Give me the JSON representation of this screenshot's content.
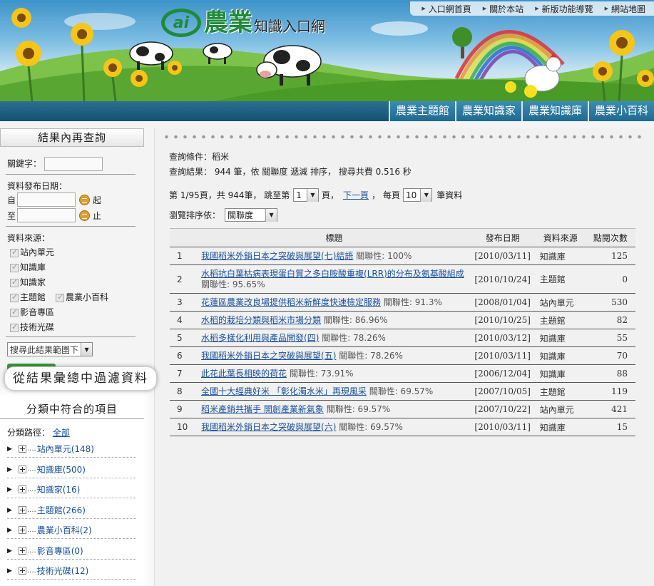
{
  "header": {
    "logo_main": "農業",
    "logo_sub": "知識入口網",
    "top_links": [
      "入口網首頁",
      "關於本站",
      "新版功能導覽",
      "網站地圖"
    ],
    "nav_tabs": [
      "農業主題館",
      "農業知識家",
      "農業知識庫",
      "農業小百科"
    ]
  },
  "left": {
    "search_title": "結果內再查詢",
    "keyword_label": "關鍵字：",
    "date_label": "資料發布日期：",
    "from_label": "自",
    "to_label": "至",
    "start_label": "起",
    "end_label": "止",
    "source_label": "資料來源：",
    "sources": [
      "站內單元",
      "知識庫",
      "知識家",
      "主題館",
      "農業小百科",
      "影音專區",
      "技術光碟"
    ],
    "scope_select": "搜尋此結果範圍下",
    "callout": "從結果彙總中過濾資料",
    "category_title": "分類中符合的項目",
    "path_label": "分類路徑：",
    "path_link": "全部",
    "categories": [
      "站內單元(148)",
      "知識庫(500)",
      "知識家(16)",
      "主題館(266)",
      "農業小百科(2)",
      "影音專區(0)",
      "技術光碟(12)"
    ]
  },
  "main": {
    "condition": "查詢條件：稻米",
    "result_summary": "查詢結果： 944 筆，依 關聯度 遞減 排序， 搜尋共費 0.516 秒",
    "pager_prefix": "第 1/95頁，共 944筆， 跳至第",
    "page_value": "1",
    "page_suffix": "頁，",
    "next_page": "下一頁",
    "per_page_label": "每頁",
    "per_page_value": "10",
    "per_page_suffix": "筆資料",
    "sort_label": "瀏覽排序依：",
    "sort_value": "關聯度",
    "columns": [
      "標題",
      "發布日期",
      "資料來源",
      "點閱次數"
    ],
    "rows": [
      {
        "no": "1",
        "title": "我國稻米外銷日本之突破與展望(七)結語",
        "rel": "關聯性: 100%",
        "date": "[2010/03/11]",
        "source": "知識庫",
        "views": "125"
      },
      {
        "no": "2",
        "title": "水稻抗白葉枯病表現蛋白質之多白胺酸重複(LRR)的分布及氨基酸組成",
        "rel": "關聯性: 95.65%",
        "date": "[2010/10/24]",
        "source": "主題館",
        "views": "0"
      },
      {
        "no": "3",
        "title": "花蓮區農業改良場提供稻米新鮮度快速檢定服務",
        "rel": "關聯性: 91.3%",
        "date": "[2008/01/04]",
        "source": "站內單元",
        "views": "530"
      },
      {
        "no": "4",
        "title": "水稻的栽培分類與稻米市場分類",
        "rel": "關聯性: 86.96%",
        "date": "[2010/10/25]",
        "source": "主題館",
        "views": "82"
      },
      {
        "no": "5",
        "title": "水稻多樣化利用與產品開發(四)",
        "rel": "關聯性: 78.26%",
        "date": "[2010/03/12]",
        "source": "知識庫",
        "views": "55"
      },
      {
        "no": "6",
        "title": "我國稻米外銷日本之突破與展望(五)",
        "rel": "關聯性: 78.26%",
        "date": "[2010/03/11]",
        "source": "知識庫",
        "views": "70"
      },
      {
        "no": "7",
        "title": "此花此葉長相映的荷花",
        "rel": "關聯性: 73.91%",
        "date": "[2006/12/04]",
        "source": "知識庫",
        "views": "88"
      },
      {
        "no": "8",
        "title": "全國十大經典好米 「彰化濁水米」再現風采",
        "rel": "關聯性: 69.57%",
        "date": "[2007/10/05]",
        "source": "主題館",
        "views": "119"
      },
      {
        "no": "9",
        "title": "稻米產銷共攜手 開創產業新氣象",
        "rel": "關聯性: 69.57%",
        "date": "[2007/10/22]",
        "source": "站內單元",
        "views": "421"
      },
      {
        "no": "10",
        "title": "我國稻米外銷日本之突破與展望(六)",
        "rel": "關聯性: 69.57%",
        "date": "[2010/03/11]",
        "source": "知識庫",
        "views": "15"
      }
    ]
  }
}
